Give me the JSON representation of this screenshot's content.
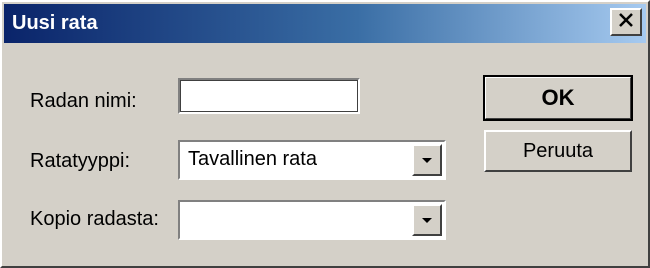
{
  "window": {
    "title": "Uusi rata",
    "close_symbol": "X"
  },
  "form": {
    "track_name": {
      "label": "Radan nimi:",
      "value": ""
    },
    "track_type": {
      "label": "Ratatyyppi:",
      "selected": "Tavallinen rata"
    },
    "copy_from": {
      "label": "Kopio radasta:",
      "selected": ""
    }
  },
  "buttons": {
    "ok_label": "OK",
    "cancel_label": "Peruuta"
  },
  "icons": {
    "close": "close-icon",
    "dropdown": "chevron-down-icon"
  },
  "colors": {
    "titlebar_start": "#0a246a",
    "titlebar_end": "#a6caf0",
    "face": "#d4d0c8"
  }
}
